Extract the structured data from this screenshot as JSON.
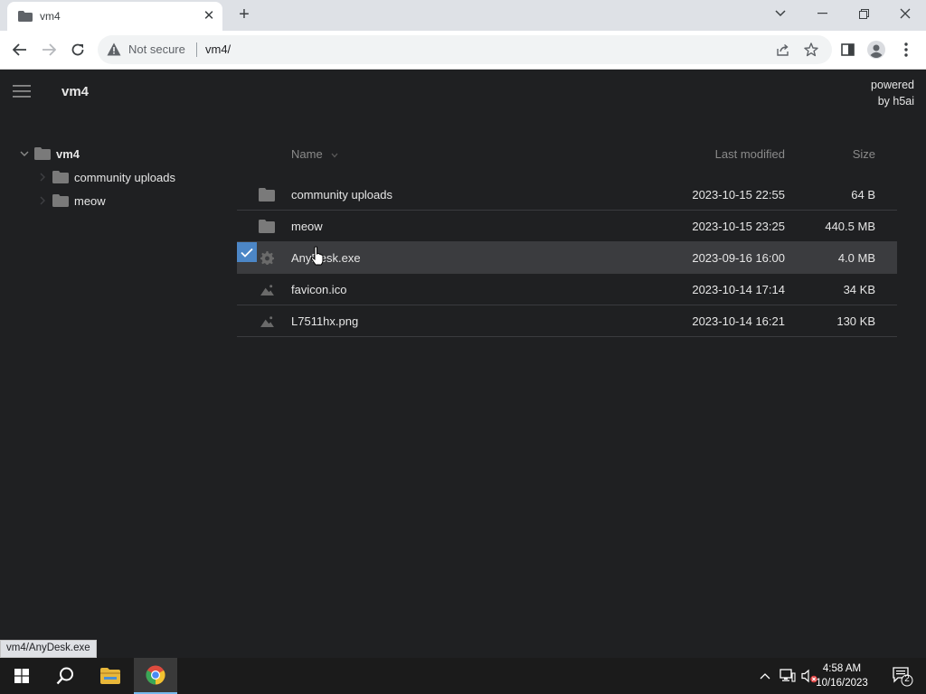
{
  "browser": {
    "tab_title": "vm4",
    "security_label": "Not secure",
    "url": "vm4/"
  },
  "header": {
    "breadcrumb": "vm4",
    "powered_line1": "powered",
    "powered_line2": "by h5ai"
  },
  "tree": {
    "root": "vm4",
    "children": [
      "community uploads",
      "meow"
    ]
  },
  "columns": {
    "name": "Name",
    "modified": "Last modified",
    "size": "Size"
  },
  "files": [
    {
      "name": "community uploads",
      "modified": "2023-10-15 22:55",
      "size": "64 B",
      "icon": "folder-icon"
    },
    {
      "name": "meow",
      "modified": "2023-10-15 23:25",
      "size": "440.5 MB",
      "icon": "folder-icon"
    },
    {
      "name": "AnyDesk.exe",
      "modified": "2023-09-16 16:00",
      "size": "4.0 MB",
      "icon": "gear-icon",
      "selected": true
    },
    {
      "name": "favicon.ico",
      "modified": "2023-10-14 17:14",
      "size": "34 KB",
      "icon": "image-icon"
    },
    {
      "name": "L7511hx.png",
      "modified": "2023-10-14 16:21",
      "size": "130 KB",
      "icon": "image-icon"
    }
  ],
  "status_url": "vm4/AnyDesk.exe",
  "taskbar": {
    "time": "4:58 AM",
    "date": "10/16/2023",
    "notification_count": "2"
  },
  "colors": {
    "page_bg": "#1f2022",
    "selection_accent": "#4c86c6",
    "selected_row_bg": "#3b3c3f"
  }
}
